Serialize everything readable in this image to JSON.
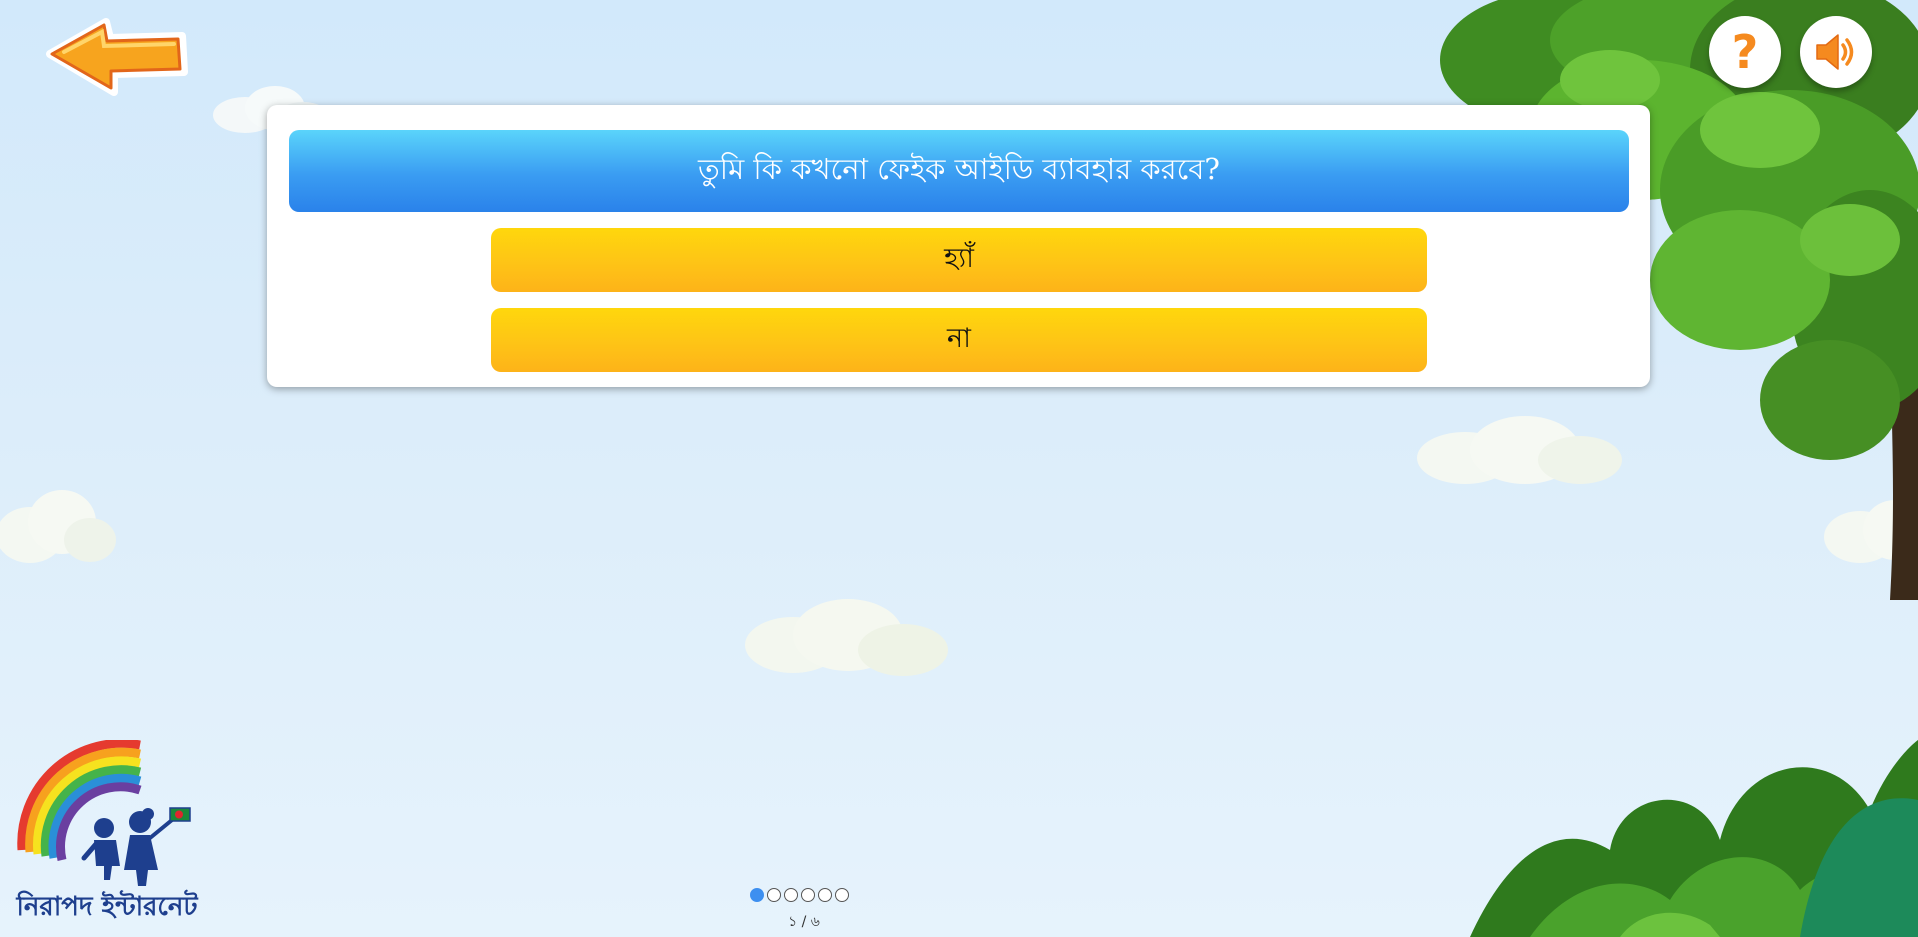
{
  "question": "তুমি কি কখনো ফেইক আইডি ব্যাবহার করবে?",
  "options": [
    "হ্যাঁ",
    "না"
  ],
  "pager": {
    "total_dots": 6,
    "current_dot": 1,
    "counter": "১ / ৬"
  },
  "logo": {
    "text": "নিরাপদ ইন্টারনেট"
  },
  "icons": {
    "back": "arrow-left-icon",
    "help": "question-mark-icon",
    "sound": "speaker-icon"
  },
  "buttons": {
    "help_glyph": "?"
  },
  "colors": {
    "question_bar": "#3a9cf2",
    "option_button": "#fec416",
    "active_dot": "#3d8ff0",
    "arrow": "#f7a41e",
    "logo_text": "#1e3f8e"
  }
}
